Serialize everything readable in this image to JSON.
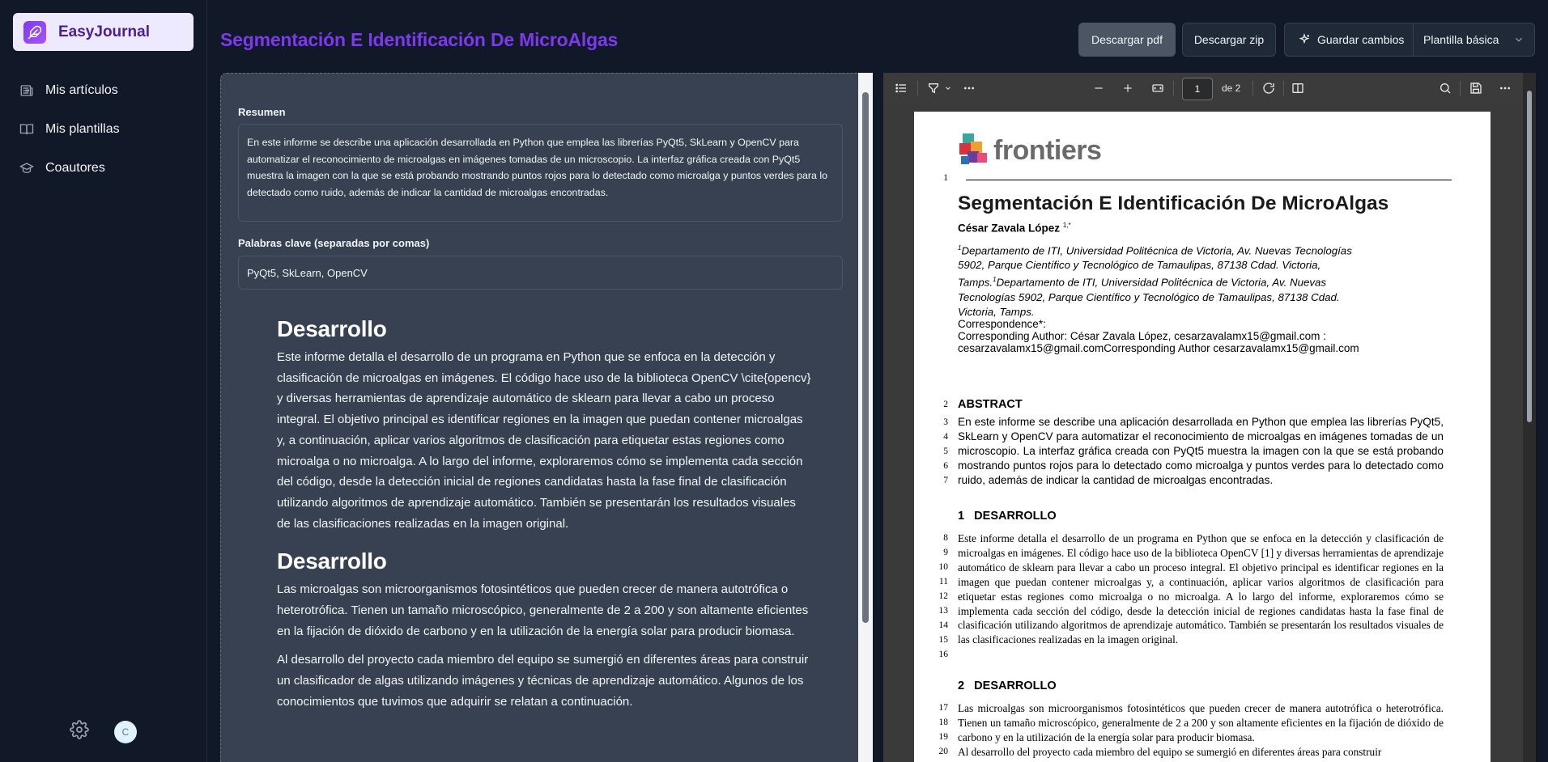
{
  "app": {
    "name": "EasyJournal"
  },
  "sidebar": {
    "items": [
      {
        "label": "Mis artículos",
        "icon": "newspaper-icon"
      },
      {
        "label": "Mis plantillas",
        "icon": "book-icon"
      },
      {
        "label": "Coautores",
        "icon": "graduation-cap-icon"
      }
    ],
    "avatar_initial": "C"
  },
  "header": {
    "title": "Segmentación E Identificación De MicroAlgas",
    "download_pdf": "Descargar pdf",
    "download_zip": "Descargar zip",
    "save_changes": "Guardar cambios",
    "template_selected": "Plantilla básica"
  },
  "editor": {
    "resumen_label": "Resumen",
    "resumen_value": "En este informe se describe una aplicación desarrollada en Python que emplea las librerías PyQt5, SkLearn y OpenCV para automatizar el reconocimiento de microalgas en imágenes tomadas de un microscopio. La interfaz gráfica creada con PyQt5 muestra la imagen con la que se está probando mostrando puntos rojos para lo detectado como microalga y puntos verdes para lo detectado como ruido, además de indicar la cantidad de microalgas encontradas.",
    "keywords_label": "Palabras clave (separadas por comas)",
    "keywords_value": "PyQt5, SkLearn, OpenCV",
    "section1_heading": "Desarrollo",
    "section1_text": "Este informe detalla el desarrollo de un programa en Python que se enfoca en la detección y clasificación de microalgas en imágenes. El código hace uso de la biblioteca OpenCV \\cite{opencv} y diversas herramientas de aprendizaje automático de sklearn para llevar a cabo un proceso integral. El objetivo principal es identificar regiones en la imagen que puedan contener microalgas y, a continuación, aplicar varios algoritmos de clasificación para etiquetar estas regiones como microalga o no microalga. A lo largo del informe, exploraremos cómo se implementa cada sección del código, desde la detección inicial de regiones candidatas hasta la fase final de clasificación utilizando algoritmos de aprendizaje automático. También se presentarán los resultados visuales de las clasificaciones realizadas en la imagen original.",
    "section2_heading": "Desarrollo",
    "section2_text": "Las microalgas son microorganismos fotosintéticos que pueden crecer de manera autotrófica o heterotrófica. Tienen un tamaño microscópico, generalmente de 2 a 200 y son altamente eficientes en la fijación de dióxido de carbono y en la utilización de la energía solar para producir biomasa.",
    "section2_text2": "Al desarrollo del proyecto cada miembro del equipo se sumergió en diferentes áreas para construir un clasificador de algas utilizando imágenes y técnicas de aprendizaje automático. Algunos de los conocimientos que tuvimos que adquirir se relatan a continuación."
  },
  "viewer": {
    "page_current": "1",
    "page_of": "de 2",
    "pdf": {
      "logo_text": "frontiers",
      "title": "Segmentación E Identificación De MicroAlgas",
      "author": "César Zavala López",
      "author_sup": "1,*",
      "affiliation": "Departamento de ITI, Universidad Politécnica de Victoria, Av. Nuevas Tecnologías 5902, Parque Científico y Tecnológico de Tamaulipas, 87138 Cdad. Victoria, Tamps.",
      "affiliation2": "Departamento de ITI, Universidad Politécnica de Victoria, Av. Nuevas Tecnologías 5902, Parque Científico y Tecnológico de Tamaulipas, 87138 Cdad. Victoria, Tamps.",
      "sup1": "1",
      "correspondence_label": "Correspondence*:",
      "correspondence_text": "Corresponding Author: César Zavala López, cesarzavalamx15@gmail.com : cesarzavalamx15@gmail.comCorresponding Author cesarzavalamx15@gmail.com",
      "abstract_heading": "ABSTRACT",
      "abstract_text": "En este informe se describe una aplicación desarrollada en Python que emplea las librerías PyQt5, SkLearn y OpenCV para automatizar el reconocimiento de microalgas en imágenes tomadas de un microscopio. La interfaz gráfica creada con PyQt5 muestra la imagen con la que se está probando mostrando puntos rojos para lo detectado como microalga y puntos verdes para lo detectado como ruido, además de indicar la cantidad de microalgas encontradas.",
      "sec1_num": "1",
      "sec1_heading": "DESARROLLO",
      "sec1_text": "Este informe detalla el desarrollo de un programa en Python que se enfoca en la detección y clasificación de microalgas en imágenes. El código hace uso de la biblioteca OpenCV [1] y diversas herramientas de aprendizaje automático de sklearn para llevar a cabo un proceso integral. El objetivo principal es identificar regiones en la imagen que puedan contener microalgas y, a continuación, aplicar varios algoritmos de clasificación para etiquetar estas regiones como microalga o no microalga. A lo largo del informe, exploraremos cómo se implementa cada sección del código, desde la detección inicial de regiones candidatas hasta la fase final de clasificación utilizando algoritmos de aprendizaje automático. También se presentarán los resultados visuales de las clasificaciones realizadas en la imagen original.",
      "sec2_num": "2",
      "sec2_heading": "DESARROLLO",
      "sec2_text": "Las microalgas son microorganismos fotosintéticos que pueden crecer de manera autotrófica o heterotrófica. Tienen un tamaño microscópico, generalmente de 2 a 200 y son altamente eficientes en la fijación de dióxido de carbono y en la utilización de la energía solar para producir biomasa.",
      "sec2_text2": "Al desarrollo del proyecto cada miembro del equipo se sumergió en diferentes áreas para construir",
      "line_numbers": [
        "1",
        "2",
        "3",
        "4",
        "5",
        "6",
        "7",
        "8",
        "9",
        "10",
        "11",
        "12",
        "13",
        "14",
        "15",
        "16",
        "17",
        "18",
        "19",
        "20"
      ]
    }
  },
  "colors": {
    "accent": "#7c3aed",
    "background": "#111827",
    "panel": "#374151"
  }
}
